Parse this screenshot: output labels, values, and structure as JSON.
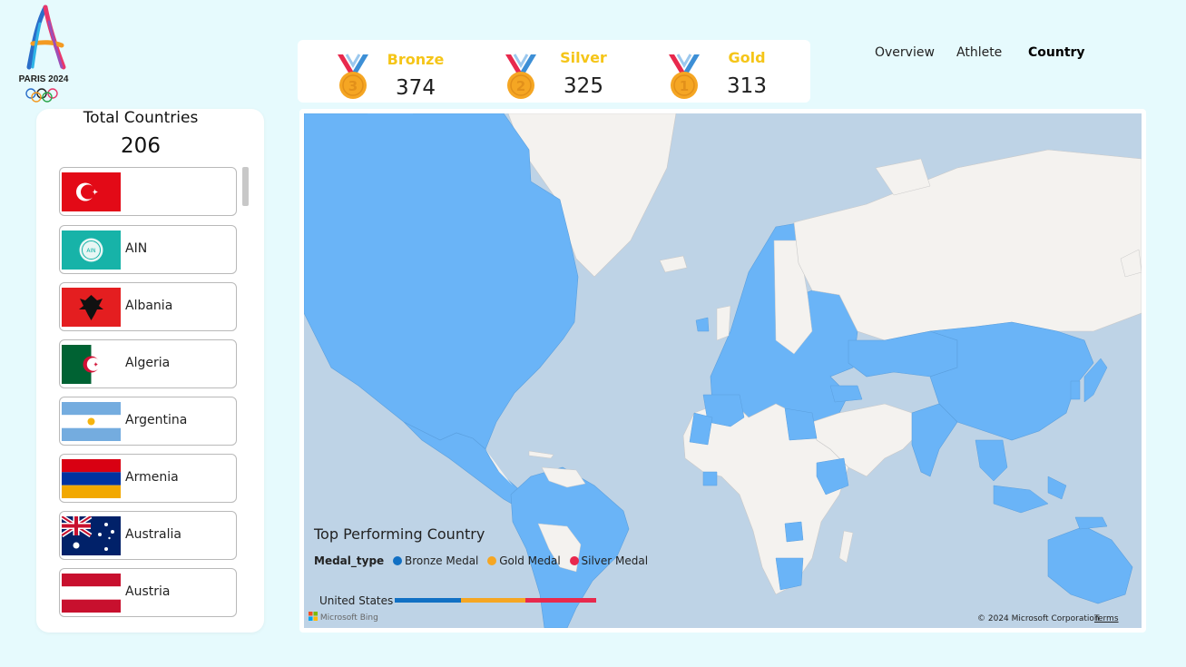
{
  "logo": {
    "text": "PARIS 2024"
  },
  "medals": {
    "bronze": {
      "label": "Bronze",
      "value": "374",
      "number": "3",
      "color": "#f5a623"
    },
    "silver": {
      "label": "Silver",
      "value": "325",
      "number": "2",
      "color": "#f5a623"
    },
    "gold": {
      "label": "Gold",
      "value": "313",
      "number": "1",
      "color": "#f5a623"
    }
  },
  "nav": {
    "overview": "Overview",
    "athlete": "Athlete",
    "country": "Country",
    "active": "Country"
  },
  "summary": {
    "label": "Total Countries",
    "value": "206"
  },
  "countries": [
    {
      "name": "",
      "flag": "turkey-flag"
    },
    {
      "name": "AIN",
      "flag": "ain-flag"
    },
    {
      "name": "Albania",
      "flag": "albania-flag"
    },
    {
      "name": "Algeria",
      "flag": "algeria-flag"
    },
    {
      "name": "Argentina",
      "flag": "argentina-flag"
    },
    {
      "name": "Armenia",
      "flag": "armenia-flag"
    },
    {
      "name": "Australia",
      "flag": "australia-flag"
    },
    {
      "name": "Austria",
      "flag": "austria-flag"
    }
  ],
  "map": {
    "title": "Top Performing Country",
    "legend_label": "Medal_type",
    "legend": [
      {
        "name": "Bronze Medal",
        "color": "#1170c4"
      },
      {
        "name": "Gold Medal",
        "color": "#f5a623"
      },
      {
        "name": "Silver Medal",
        "color": "#e8294d"
      }
    ],
    "bar": {
      "country": "United States",
      "segments": [
        {
          "medal": "Bronze Medal",
          "color": "#1170c4"
        },
        {
          "medal": "Gold Medal",
          "color": "#f5a623"
        },
        {
          "medal": "Silver Medal",
          "color": "#e8294d"
        }
      ]
    },
    "provider": "Microsoft Bing",
    "copyright": "© 2024 Microsoft Corporation",
    "terms": "Terms",
    "colors": {
      "ocean": "#bed3e6",
      "highlight": "#6ab4f7",
      "land": "#f4f2ef"
    }
  }
}
